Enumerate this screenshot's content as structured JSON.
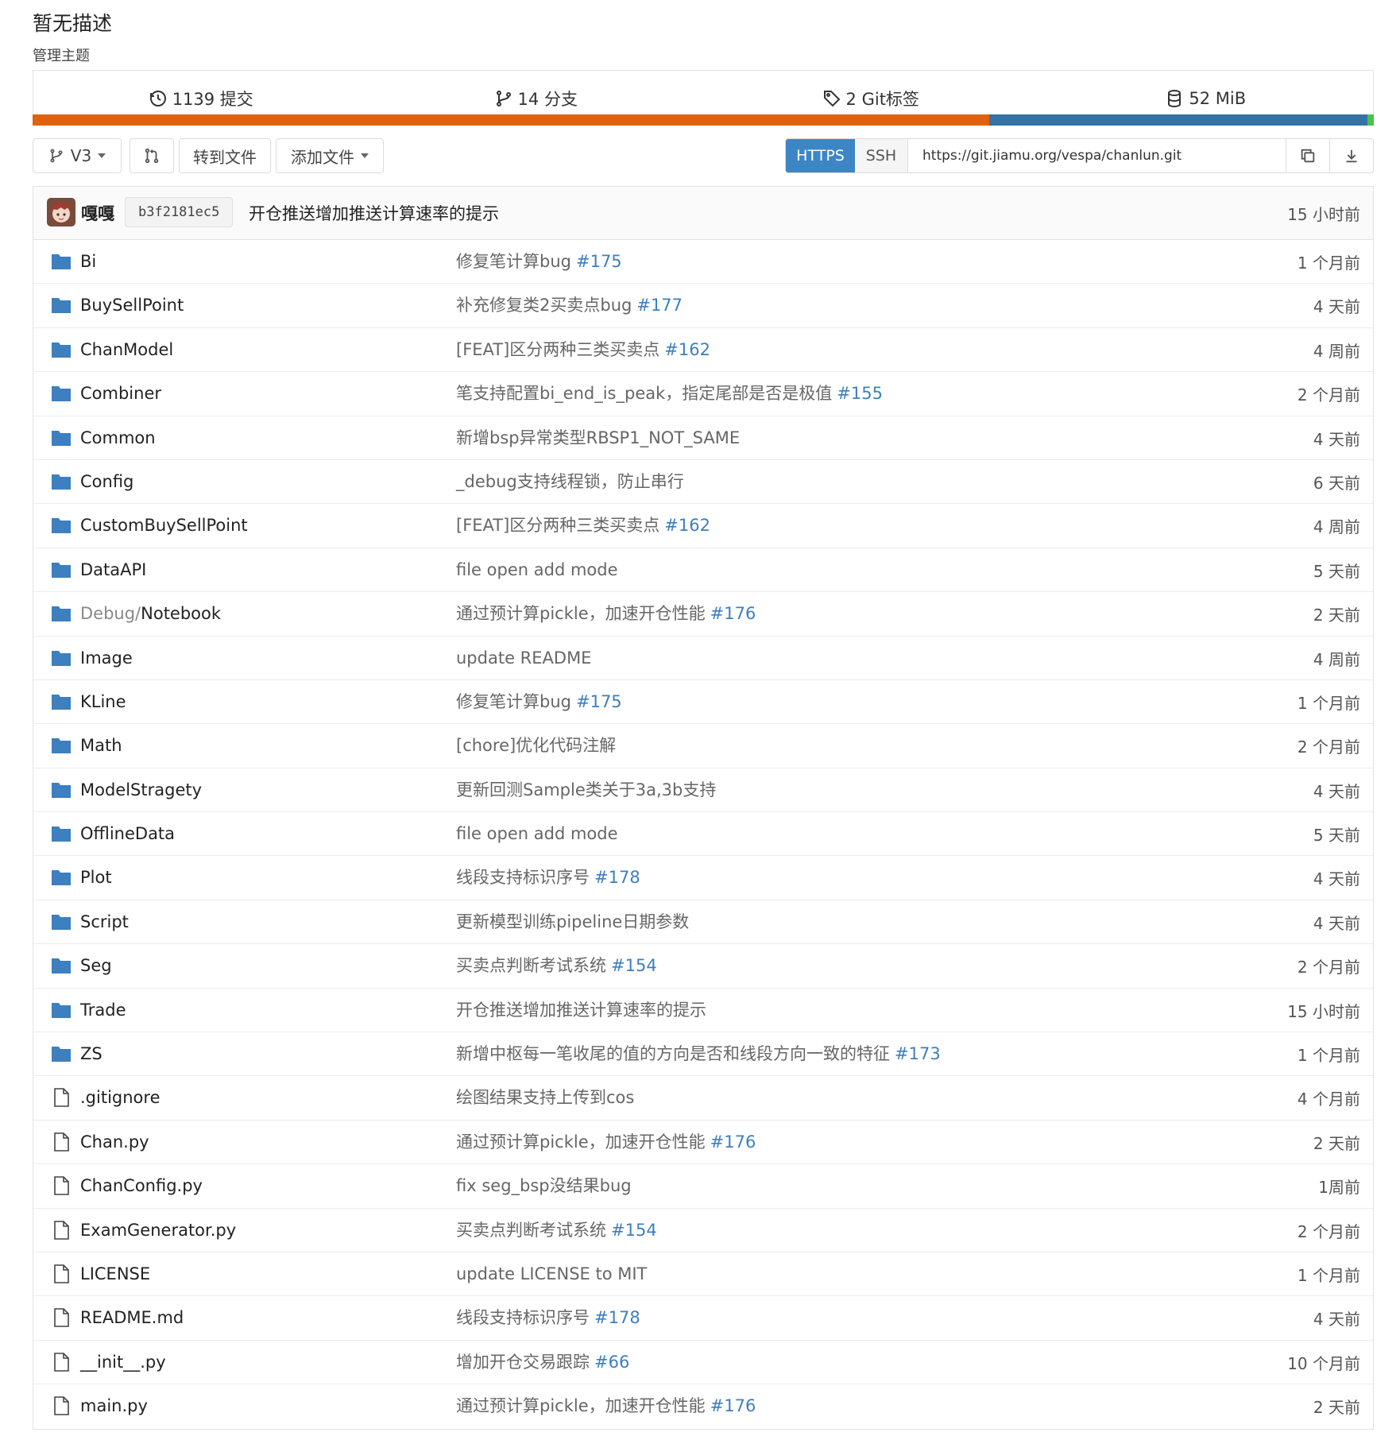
{
  "header": {
    "description": "暂无描述",
    "manage_topics": "管理主题"
  },
  "stats": [
    {
      "icon": "history-icon",
      "label": "1139 提交"
    },
    {
      "icon": "branch-icon",
      "label": "14 分支"
    },
    {
      "icon": "tag-icon",
      "label": "2 Git标签"
    },
    {
      "icon": "database-icon",
      "label": "52 MiB"
    }
  ],
  "language_bar": {
    "colors": [
      "#e0610e",
      "#3572a5",
      "#4ac34a"
    ],
    "fractions": [
      0.713,
      0.282,
      0.005
    ]
  },
  "toolbar": {
    "branch": "V3",
    "goto_file": "转到文件",
    "add_file": "添加文件",
    "https": "HTTPS",
    "ssh": "SSH",
    "clone_url": "https://git.jiamu.org/vespa/chanlun.git"
  },
  "latest_commit": {
    "author": "嘎嘎",
    "sha": "b3f2181ec5",
    "message": "开仓推送增加推送计算速率的提示",
    "time": "15 小时前"
  },
  "files": [
    {
      "type": "folder",
      "name": "Bi",
      "message": "修复笔计算bug",
      "link": "#175",
      "time": "1 个月前"
    },
    {
      "type": "folder",
      "name": "BuySellPoint",
      "message": "补充修复类2买卖点bug",
      "link": "#177",
      "time": "4 天前"
    },
    {
      "type": "folder",
      "name": "ChanModel",
      "message": "[FEAT]区分两种三类买卖点",
      "link": "#162",
      "time": "4 周前"
    },
    {
      "type": "folder",
      "name": "Combiner",
      "message": "笔支持配置bi_end_is_peak，指定尾部是否是极值",
      "link": "#155",
      "time": "2 个月前"
    },
    {
      "type": "folder",
      "name": "Common",
      "message": "新增bsp异常类型RBSP1_NOT_SAME",
      "link": "",
      "time": "4 天前"
    },
    {
      "type": "folder",
      "name": "Config",
      "message": "_debug支持线程锁，防止串行",
      "link": "",
      "time": "6 天前"
    },
    {
      "type": "folder",
      "name": "CustomBuySellPoint",
      "message": "[FEAT]区分两种三类买卖点",
      "link": "#162",
      "time": "4 周前"
    },
    {
      "type": "folder",
      "name": "DataAPI",
      "message": "file open add mode",
      "link": "",
      "time": "5 天前"
    },
    {
      "type": "folder",
      "name_dim": "Debug/",
      "name": "Notebook",
      "message": "通过预计算pickle，加速开仓性能",
      "link": "#176",
      "time": "2 天前"
    },
    {
      "type": "folder",
      "name": "Image",
      "message": "update README",
      "link": "",
      "time": "4 周前"
    },
    {
      "type": "folder",
      "name": "KLine",
      "message": "修复笔计算bug",
      "link": "#175",
      "time": "1 个月前"
    },
    {
      "type": "folder",
      "name": "Math",
      "message": "[chore]优化代码注解",
      "link": "",
      "time": "2 个月前"
    },
    {
      "type": "folder",
      "name": "ModelStragety",
      "message": "更新回测Sample类关于3a,3b支持",
      "link": "",
      "time": "4 天前"
    },
    {
      "type": "folder",
      "name": "OfflineData",
      "message": "file open add mode",
      "link": "",
      "time": "5 天前"
    },
    {
      "type": "folder",
      "name": "Plot",
      "message": "线段支持标识序号",
      "link": "#178",
      "time": "4 天前"
    },
    {
      "type": "folder",
      "name": "Script",
      "message": "更新模型训练pipeline日期参数",
      "link": "",
      "time": "4 天前"
    },
    {
      "type": "folder",
      "name": "Seg",
      "message": "买卖点判断考试系统",
      "link": "#154",
      "time": "2 个月前"
    },
    {
      "type": "folder",
      "name": "Trade",
      "message": "开仓推送增加推送计算速率的提示",
      "link": "",
      "time": "15 小时前"
    },
    {
      "type": "folder",
      "name": "ZS",
      "message": "新增中枢每一笔收尾的值的方向是否和线段方向一致的特征",
      "link": "#173",
      "time": "1 个月前"
    },
    {
      "type": "file",
      "name": ".gitignore",
      "message": "绘图结果支持上传到cos",
      "link": "",
      "time": "4 个月前"
    },
    {
      "type": "file",
      "name": "Chan.py",
      "message": "通过预计算pickle，加速开仓性能",
      "link": "#176",
      "time": "2 天前"
    },
    {
      "type": "file",
      "name": "ChanConfig.py",
      "message": "fix seg_bsp没结果bug",
      "link": "",
      "time": "1周前"
    },
    {
      "type": "file",
      "name": "ExamGenerator.py",
      "message": "买卖点判断考试系统",
      "link": "#154",
      "time": "2 个月前"
    },
    {
      "type": "file",
      "name": "LICENSE",
      "message": "update LICENSE to MIT",
      "link": "",
      "time": "1 个月前"
    },
    {
      "type": "file",
      "name": "README.md",
      "message": "线段支持标识序号",
      "link": "#178",
      "time": "4 天前"
    },
    {
      "type": "file",
      "name": "__init__.py",
      "message": "增加开仓交易跟踪",
      "link": "#66",
      "time": "10 个月前"
    },
    {
      "type": "file",
      "name": "main.py",
      "message": "通过预计算pickle，加速开仓性能",
      "link": "#176",
      "time": "2 天前"
    }
  ]
}
